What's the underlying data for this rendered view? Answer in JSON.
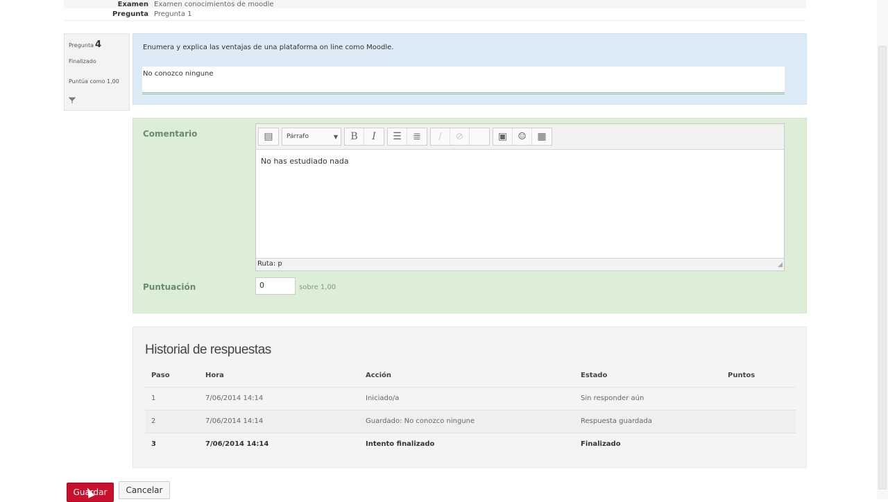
{
  "summary": {
    "exam_label": "Examen",
    "exam_value": "Examen conocimientos de moodle",
    "question_label": "Pregunta",
    "question_value": "Pregunta 1"
  },
  "question_info": {
    "question_prefix": "Pregunta",
    "question_number": "4",
    "state": "Finalizado",
    "grade": "Puntúa como 1,00",
    "flag_icon": "flag-icon"
  },
  "question": {
    "text": "Enumera y explica las ventajas de una plataforma on line como Moodle.",
    "answer": "No conozco ningune"
  },
  "comment": {
    "label": "Comentario",
    "toolbar": {
      "format_select": "Párrafo",
      "icons": [
        "collapse-icon",
        "bold-icon",
        "italic-icon",
        "unordered-list-icon",
        "ordered-list-icon",
        "link-icon",
        "unlink-icon",
        "image-icon",
        "emoticon-icon",
        "media-icon"
      ]
    },
    "text": "No has estudiado nada",
    "path": "Ruta: p"
  },
  "grading": {
    "label": "Puntuación",
    "value": "0",
    "out_of": "sobre 1,00"
  },
  "history": {
    "title": "Historial de respuestas",
    "columns": [
      "Paso",
      "Hora",
      "Acción",
      "Estado",
      "Puntos"
    ],
    "rows": [
      {
        "step": "1",
        "time": "7/06/2014 14:14",
        "action": "Iniciado/a",
        "state": "Sin responder aún",
        "points": ""
      },
      {
        "step": "2",
        "time": "7/06/2014 14:14",
        "action": "Guardado: No conozco ningune",
        "state": "Respuesta guardada",
        "points": ""
      },
      {
        "step": "3",
        "time": "7/06/2014 14:14",
        "action": "Intento finalizado",
        "state": "Finalizado",
        "points": ""
      }
    ]
  },
  "buttons": {
    "save": "Guardar",
    "cancel": "Cancelar"
  },
  "colors": {
    "save_button": "#c8102e",
    "question_bg": "#dcebf5",
    "comment_bg": "#dcefd6"
  }
}
